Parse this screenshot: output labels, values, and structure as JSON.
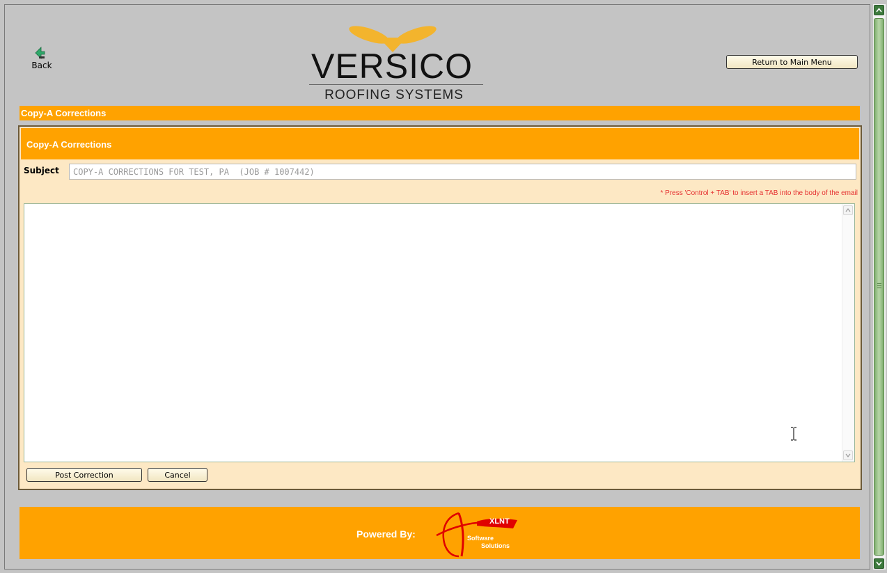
{
  "nav": {
    "back_label": "Back",
    "main_menu_label": "Return to Main Menu"
  },
  "logo": {
    "wordmark": "VERSICO",
    "tagline": "ROOFING SYSTEMS"
  },
  "page": {
    "title": "Copy-A Corrections"
  },
  "form": {
    "header": "Copy-A Corrections",
    "subject_label": "Subject",
    "subject_value": "COPY-A CORRECTIONS FOR TEST, PA  (JOB # 1007442)",
    "hint": "* Press 'Control + TAB' to insert a TAB into the body of the email",
    "body_value": "",
    "post_label": "Post Correction",
    "cancel_label": "Cancel"
  },
  "footer": {
    "powered_by": "Powered By:",
    "partner_word": "XLNT",
    "partner_line1": "Software",
    "partner_line2": "Solutions"
  },
  "colors": {
    "brand_orange": "#ffa200",
    "panel_bg": "#fde8c4",
    "hint_red": "#e53030",
    "scrollbar_green": "#7fae6f"
  },
  "icons": [
    "back-arrow-icon",
    "scroll-up-icon",
    "scroll-down-icon",
    "ibeam-cursor-icon"
  ]
}
